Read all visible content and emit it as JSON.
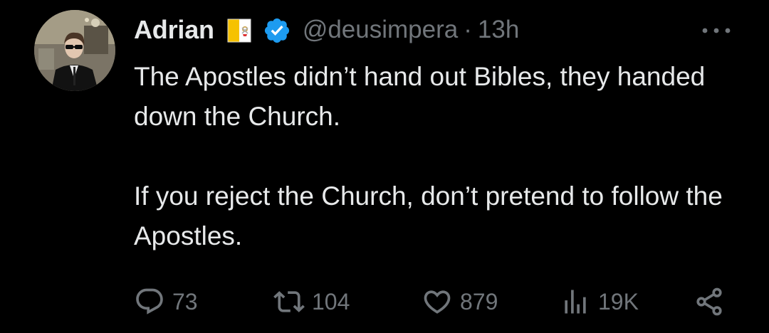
{
  "tweet": {
    "author": {
      "display_name": "Adrian",
      "handle": "@deusimpera",
      "flag_icon": "vatican-flag-icon",
      "verified_icon": "verified-badge-icon",
      "verified_color": "#1d9bf0"
    },
    "separator": "·",
    "timestamp": "13h",
    "text": {
      "line1": "The Apostles didn’t hand out Bibles, they handed down the Church.",
      "line2": "If you reject the Church, don’t pretend to follow the Apostles."
    },
    "actions": {
      "reply": {
        "icon": "reply-icon",
        "count": "73"
      },
      "repost": {
        "icon": "repost-icon",
        "count": "104"
      },
      "like": {
        "icon": "heart-icon",
        "count": "879"
      },
      "views": {
        "icon": "views-chart-icon",
        "count": "19K"
      },
      "share": {
        "icon": "share-icon"
      }
    },
    "more_icon": "more-options-icon"
  },
  "colors": {
    "background": "#000000",
    "primary_text": "#e7e9ea",
    "secondary_text": "#71767b",
    "accent": "#1d9bf0"
  }
}
